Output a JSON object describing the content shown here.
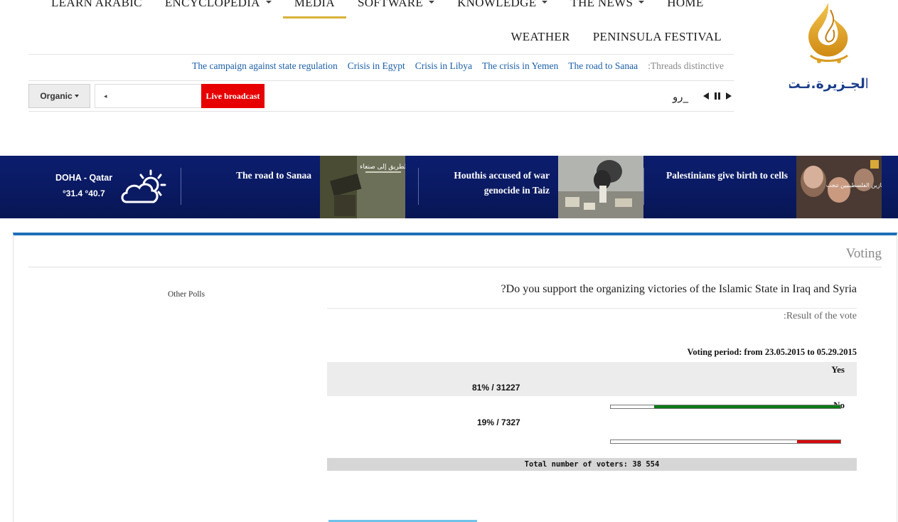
{
  "nav": {
    "row1": [
      {
        "label": "LEARN ARABIC",
        "dropdown": false,
        "active": false
      },
      {
        "label": "ENCYCLOPEDIA",
        "dropdown": true,
        "active": false
      },
      {
        "label": "MEDIA",
        "dropdown": false,
        "active": true
      },
      {
        "label": "SOFTWARE",
        "dropdown": true,
        "active": false
      },
      {
        "label": "KNOWLEDGE",
        "dropdown": true,
        "active": false
      },
      {
        "label": "THE NEWS",
        "dropdown": true,
        "active": false
      },
      {
        "label": "HOME",
        "dropdown": false,
        "active": false
      }
    ],
    "row2": [
      {
        "label": "WEATHER"
      },
      {
        "label": "PENINSULA FESTIVAL"
      }
    ]
  },
  "threads": {
    "label": ":Threads distinctive",
    "items": [
      "The campaign against state regulation",
      "Crisis in Egypt",
      "Crisis in Libya",
      "The crisis in Yemen",
      "The road to Sanaa"
    ]
  },
  "search": {
    "organic_label": "Organic",
    "live_label": "Live broadcast",
    "ticker_text": "رو_"
  },
  "logo": {
    "text": "الجـزيرة.نـت"
  },
  "weather": {
    "city": "DOHA - Qatar",
    "temps": "°31.4 °40.7"
  },
  "stories": [
    {
      "title": "The road to Sanaa",
      "image_caption": "الطريق إلى صنعاء"
    },
    {
      "title": "Houthis accused of war genocide in Taiz"
    },
    {
      "title": "Palestinians give birth to cells",
      "image_caption": "زنازين الفلسطينيين تنجب"
    }
  ],
  "poll": {
    "section_title": "Voting",
    "other_polls": "Other Polls",
    "question": "?Do you support the organizing victories of the Islamic State in Iraq and Syria",
    "result_label": ":Result of the vote",
    "period": "Voting period: from 23.05.2015 to 05.29.2015",
    "options": [
      {
        "label": "Yes",
        "value_text": "81% / 31227",
        "percent": 81
      },
      {
        "label": "No",
        "value_text": "19% / 7327",
        "percent": 19
      }
    ],
    "total": "Total number of voters: 38 554"
  },
  "colors": {
    "nav_active_underline": "#d9b238",
    "strip_blue": "#0a1a63",
    "live_red": "#e60000",
    "link_blue": "#1c5fa6",
    "panel_border": "#1d6fb8",
    "yes_bar": "#0e7a16",
    "no_bar": "#d60b0b"
  }
}
